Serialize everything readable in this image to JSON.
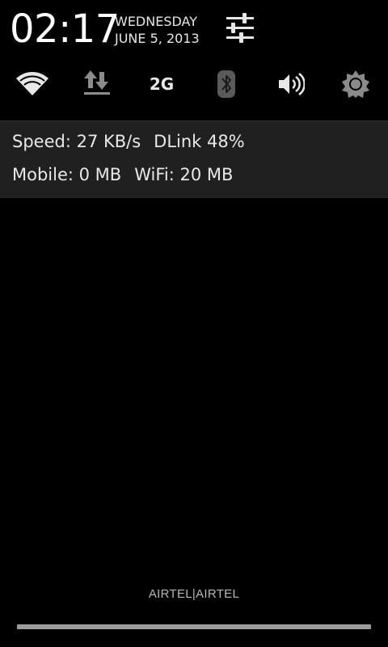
{
  "header": {
    "time": "02:17",
    "day": "WEDNESDAY",
    "date": "JUNE 5, 2013",
    "settings_icon": "settings-sliders-icon"
  },
  "quick_settings": [
    {
      "name": "wifi",
      "icon": "wifi-icon"
    },
    {
      "name": "data",
      "icon": "data-transfer-icon"
    },
    {
      "name": "network",
      "label": "2G"
    },
    {
      "name": "bluetooth",
      "icon": "bluetooth-icon"
    },
    {
      "name": "sound",
      "icon": "volume-icon"
    },
    {
      "name": "brightness",
      "icon": "brightness-icon"
    }
  ],
  "network_info": {
    "speed": "Speed: 27 KB/s",
    "wifi_network": "DLink 48%",
    "mobile_usage": "Mobile: 0 MB",
    "wifi_usage": "WiFi: 20 MB"
  },
  "carrier": "AIRTEL|AIRTEL",
  "colors": {
    "background": "#000000",
    "card": "#202020",
    "text": "#e8e8e8",
    "handle": "#9c9c9c"
  }
}
